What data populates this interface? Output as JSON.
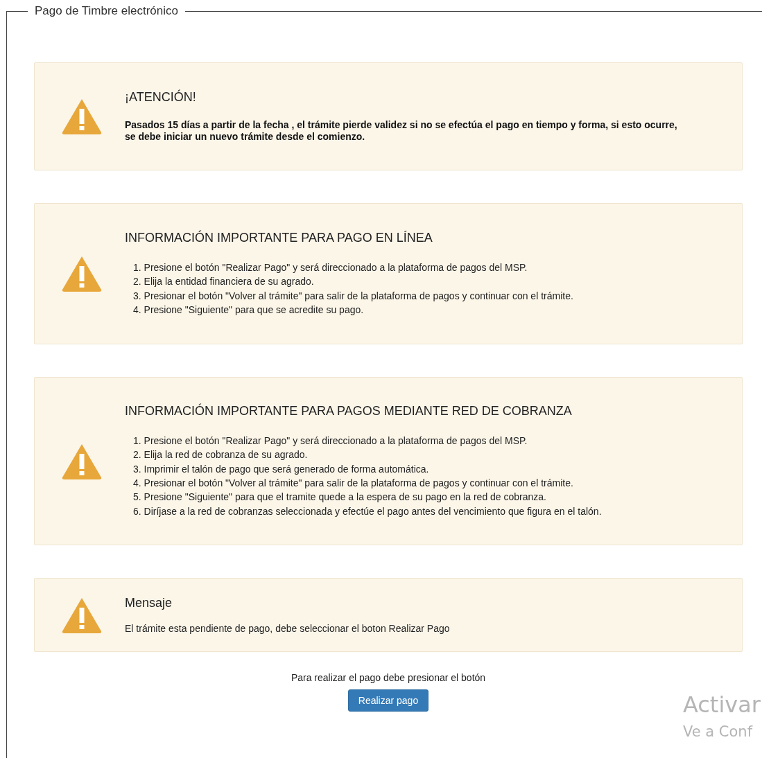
{
  "fieldset": {
    "legend": "Pago de Timbre electrónico"
  },
  "panels": [
    {
      "kind": "bold_text",
      "title": "¡ATENCIÓN!",
      "text": "Pasados 15 días a partir de la fecha , el trámite pierde validez si no se efectúa el pago en tiempo y forma, si esto ocurre, se debe iniciar un nuevo trámite desde el comienzo."
    },
    {
      "kind": "list",
      "title": "INFORMACIÓN IMPORTANTE PARA PAGO EN LÍNEA",
      "items": [
        "1. Presione el botón \"Realizar Pago\" y será direccionado a la plataforma de pagos del MSP.",
        "2. Elija la entidad financiera de su agrado.",
        "3. Presionar el botón \"Volver al trámite\" para salir de la plataforma de pagos y continuar con el trámite.",
        "4. Presione \"Siguiente\" para que se acredite su pago."
      ]
    },
    {
      "kind": "list",
      "title": "INFORMACIÓN IMPORTANTE PARA PAGOS MEDIANTE RED DE COBRANZA",
      "items": [
        "1. Presione el botón \"Realizar Pago\" y será direccionado a la plataforma de pagos del MSP.",
        "2. Elija la red de cobranza de su agrado.",
        "3. Imprimir el talón de pago que será generado de forma automática.",
        "4. Presionar el botón \"Volver al trámite\" para salir de la plataforma de pagos y continuar con el trámite.",
        "5. Presione \"Siguiente\" para que el tramite quede a la espera de su pago en la red de cobranza.",
        "6. Diríjase a la red de cobranzas seleccionada y efectúe el pago antes del vencimiento que figura en el talón."
      ]
    },
    {
      "kind": "text",
      "title": "Mensaje",
      "text": "El trámite esta pendiente de pago, debe seleccionar el boton Realizar Pago"
    }
  ],
  "payment": {
    "prompt": "Para realizar el pago debe presionar el botón",
    "button": "Realizar pago"
  },
  "activation_notice": {
    "title": "Activar",
    "subtitle": "Ve a Conf"
  }
}
